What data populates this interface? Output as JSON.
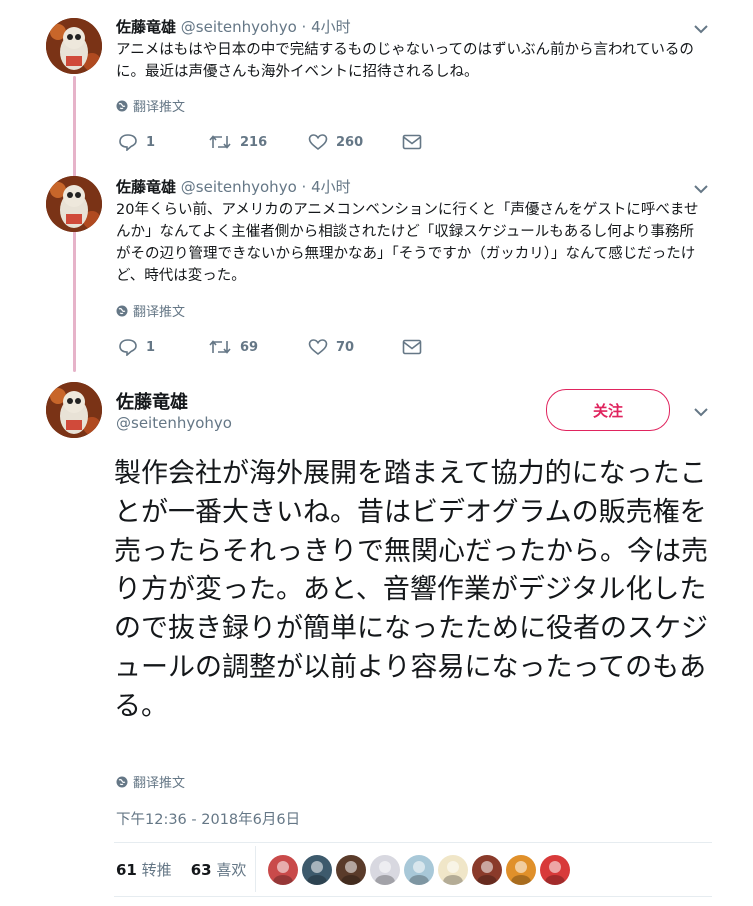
{
  "tweets": [
    {
      "name": "佐藤竜雄",
      "handle": "@seitenhyohyo",
      "time": "· 4小时",
      "text": "アニメはもはや日本の中で完結するものじゃないってのはずいぶん前から言われているのに。最近は声優さんも海外イベントに招待されるしね。",
      "translate": "翻译推文",
      "replies": "1",
      "retweets": "216",
      "likes": "260"
    },
    {
      "name": "佐藤竜雄",
      "handle": "@seitenhyohyo",
      "time": "· 4小时",
      "text": "20年くらい前、アメリカのアニメコンベンションに行くと「声優さんをゲストに呼べませんか」なんてよく主催者側から相談されたけど「収録スケジュールもあるし何より事務所がその辺り管理できないから無理かなあ」「そうですか（ガッカリ）」なんて感じだったけど、時代は変った。",
      "translate": "翻译推文",
      "replies": "1",
      "retweets": "69",
      "likes": "70"
    }
  ],
  "main_tweet": {
    "name": "佐藤竜雄",
    "handle": "@seitenhyohyo",
    "follow_label": "关注",
    "text": "製作会社が海外展開を踏まえて協力的になったことが一番大きいね。昔はビデオグラムの販売権を売ったらそれっきりで無関心だったから。今は売り方が変った。あと、音響作業がデジタル化したので抜き録りが簡単になったために役者のスケジュールの調整が以前より容易になったってのもある。",
    "translate": "翻译推文",
    "timestamp": "下午12:36 - 2018年6月6日",
    "retweet_count": "61",
    "retweet_label": "转推",
    "like_count": "63",
    "like_label": "喜欢",
    "likers": [
      {
        "name": "liker-avatar-1",
        "color": "#c94a4a"
      },
      {
        "name": "liker-avatar-2",
        "color": "#3d5a6c"
      },
      {
        "name": "liker-avatar-3",
        "color": "#5a3b2a"
      },
      {
        "name": "liker-avatar-4",
        "color": "#d8d8e0"
      },
      {
        "name": "liker-avatar-5",
        "color": "#a8c8d8"
      },
      {
        "name": "liker-avatar-6",
        "color": "#f0e6c8"
      },
      {
        "name": "liker-avatar-7",
        "color": "#8a3a2a"
      },
      {
        "name": "liker-avatar-8",
        "color": "#e0902a"
      },
      {
        "name": "liker-avatar-9",
        "color": "#d83a3a"
      }
    ]
  },
  "colors": {
    "accent": "#e0245e",
    "secondary_text": "#657786",
    "thread_line": "#e6b3c9"
  },
  "icons": {
    "reply": "reply-icon",
    "retweet": "retweet-icon",
    "like": "heart-icon",
    "dm": "envelope-icon",
    "translate": "globe-icon",
    "more": "chevron-down-icon"
  }
}
